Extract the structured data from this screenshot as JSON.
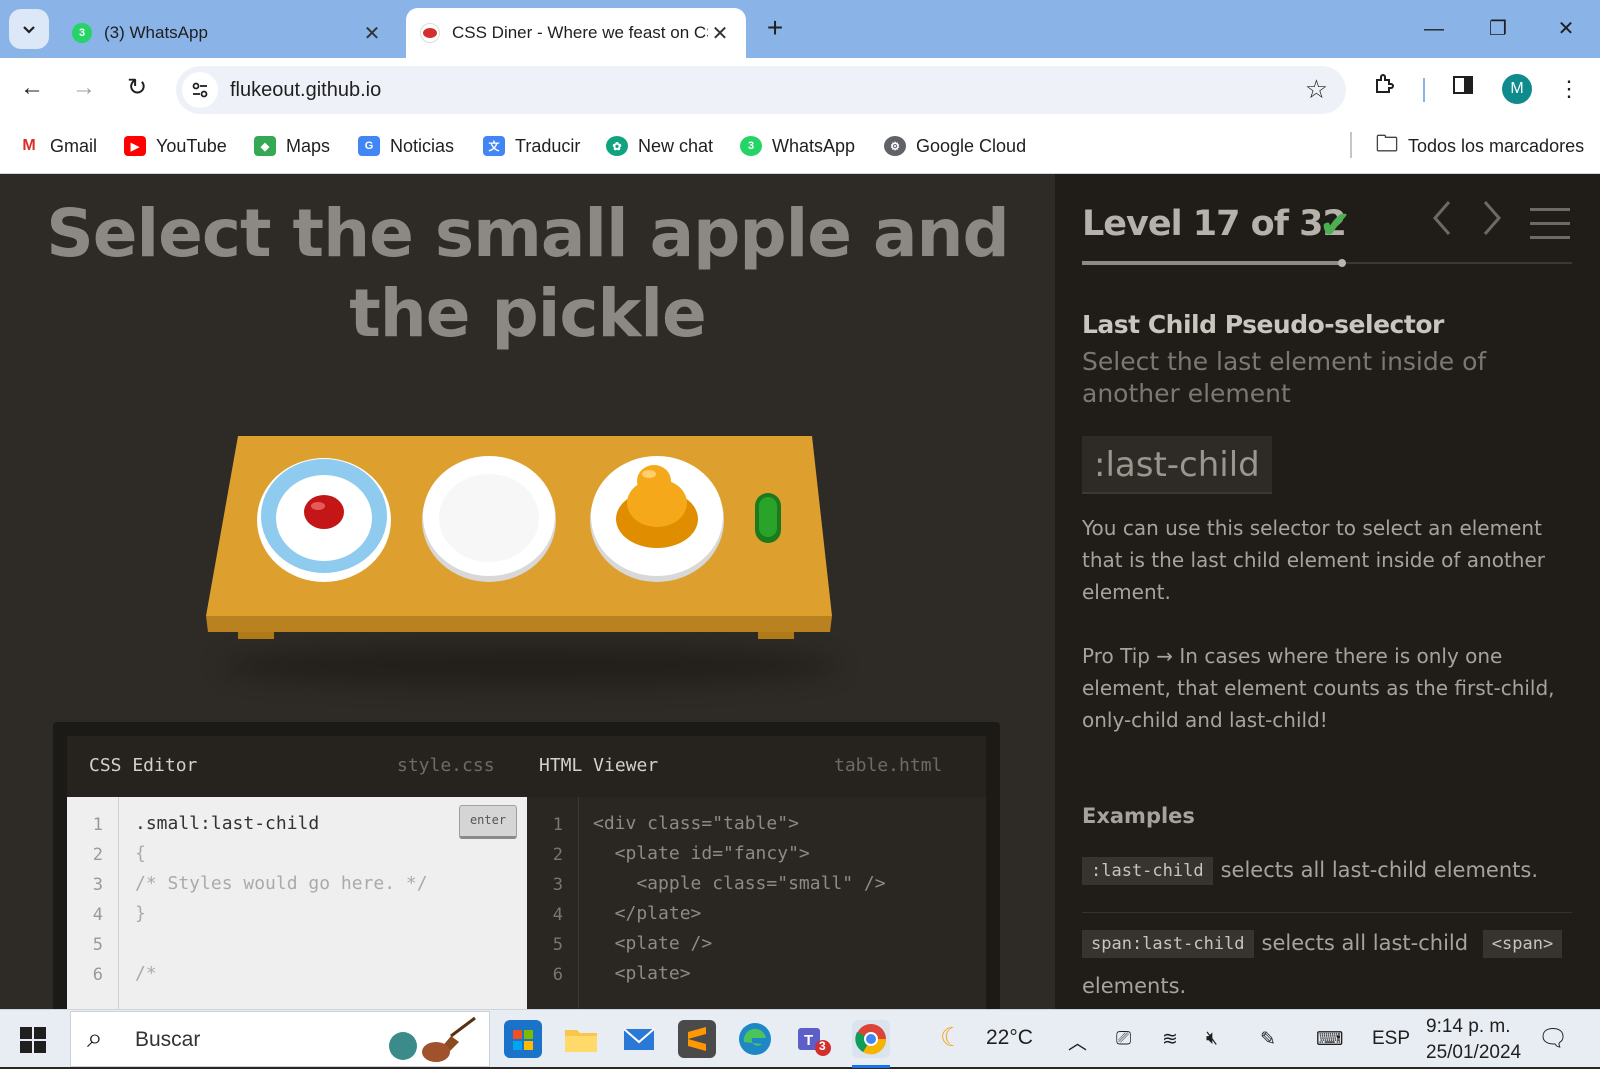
{
  "browser": {
    "tabs": [
      {
        "title": "(3) WhatsApp",
        "badge": "3",
        "active": false
      },
      {
        "title": "CSS Diner - Where we feast on CSS",
        "active": true
      }
    ],
    "url": "flukeout.github.io",
    "profile_initial": "M",
    "bookmarks": [
      "Gmail",
      "YouTube",
      "Maps",
      "Noticias",
      "Traducir",
      "New chat",
      "WhatsApp",
      "Google Cloud"
    ],
    "all_bookmarks": "Todos los marcadores"
  },
  "game": {
    "instruction": "Select the small apple and the pickle",
    "css_editor": {
      "label": "CSS Editor",
      "file": "style.css",
      "enter_label": "enter",
      "lines": [
        {
          "n": "1",
          "text": ".small:last-child"
        },
        {
          "n": "2",
          "text": "{"
        },
        {
          "n": "3",
          "text": "/* Styles would go here. */"
        },
        {
          "n": "4",
          "text": "}"
        },
        {
          "n": "5",
          "text": ""
        },
        {
          "n": "6",
          "text": "/*"
        }
      ]
    },
    "html_viewer": {
      "label": "HTML Viewer",
      "file": "table.html",
      "lines": [
        {
          "n": "1",
          "text": "<div class=\"table\">"
        },
        {
          "n": "2",
          "text": "  <plate id=\"fancy\">"
        },
        {
          "n": "3",
          "text": "    <apple class=\"small\" />"
        },
        {
          "n": "4",
          "text": "  </plate>"
        },
        {
          "n": "5",
          "text": "  <plate />"
        },
        {
          "n": "6",
          "text": "  <plate>"
        }
      ]
    }
  },
  "sidebar": {
    "level": "Level 17 of 32",
    "progress": 0.53,
    "completed": true,
    "title": "Last Child Pseudo-selector",
    "subtitle": "Select the last element inside of another element",
    "syntax": ":last-child",
    "description": "You can use this selector to select an element that is the last child element inside of another element.",
    "pro_tip": "Pro Tip → In cases where there is only one element, that element counts as the first-child, only-child and last-child!",
    "examples_heading": "Examples",
    "examples": [
      {
        "code": ":last-child",
        "text": "selects all last-child elements."
      },
      {
        "code": "span:last-child",
        "text": "selects all last-child",
        "code2": "<span>",
        "text2": "elements."
      }
    ]
  },
  "taskbar": {
    "search_placeholder": "Buscar",
    "weather": "22°C",
    "language": "ESP",
    "time": "9:14 p. m.",
    "date": "25/01/2024",
    "teams_badge": "3"
  }
}
